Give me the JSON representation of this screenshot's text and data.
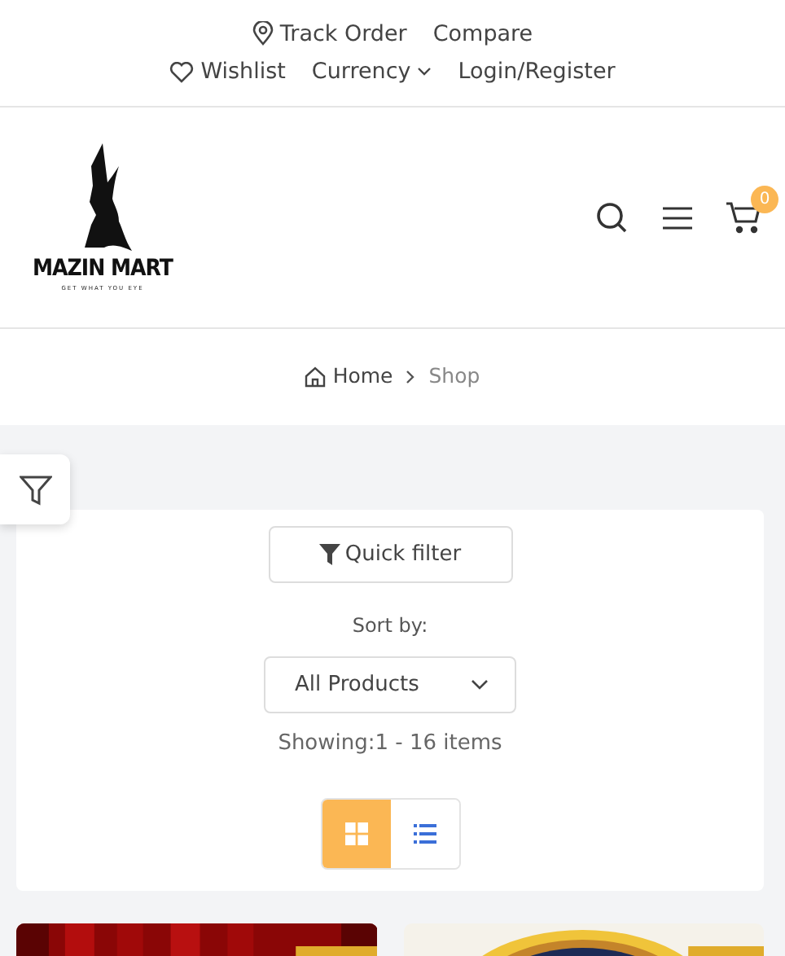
{
  "top_links": [
    {
      "kind": "location",
      "label": "Track Order"
    },
    {
      "kind": "plain",
      "label": "Compare"
    }
  ],
  "top_links_2": [
    {
      "kind": "wishlist",
      "label": "Wishlist"
    },
    {
      "kind": "dropdown",
      "label": "Currency"
    },
    {
      "kind": "plain",
      "label": "Login/Register"
    }
  ],
  "logo": {
    "name": "MAZIN MART",
    "tagline": "GET WHAT YOU EYE"
  },
  "cart": {
    "count": "0"
  },
  "breadcrumb": [
    {
      "label": "Home",
      "current": false
    },
    {
      "label": "Shop",
      "current": true
    }
  ],
  "toolbar": {
    "quick_filter": "Quick filter",
    "sort_label": "Sort by:",
    "sort_value": "All Products",
    "showing_label": "Showing:",
    "showing_value": "1 - 16 items"
  },
  "view_buttons": [
    {
      "kind": "grid",
      "selected": true
    },
    {
      "kind": "list",
      "selected": false
    }
  ]
}
